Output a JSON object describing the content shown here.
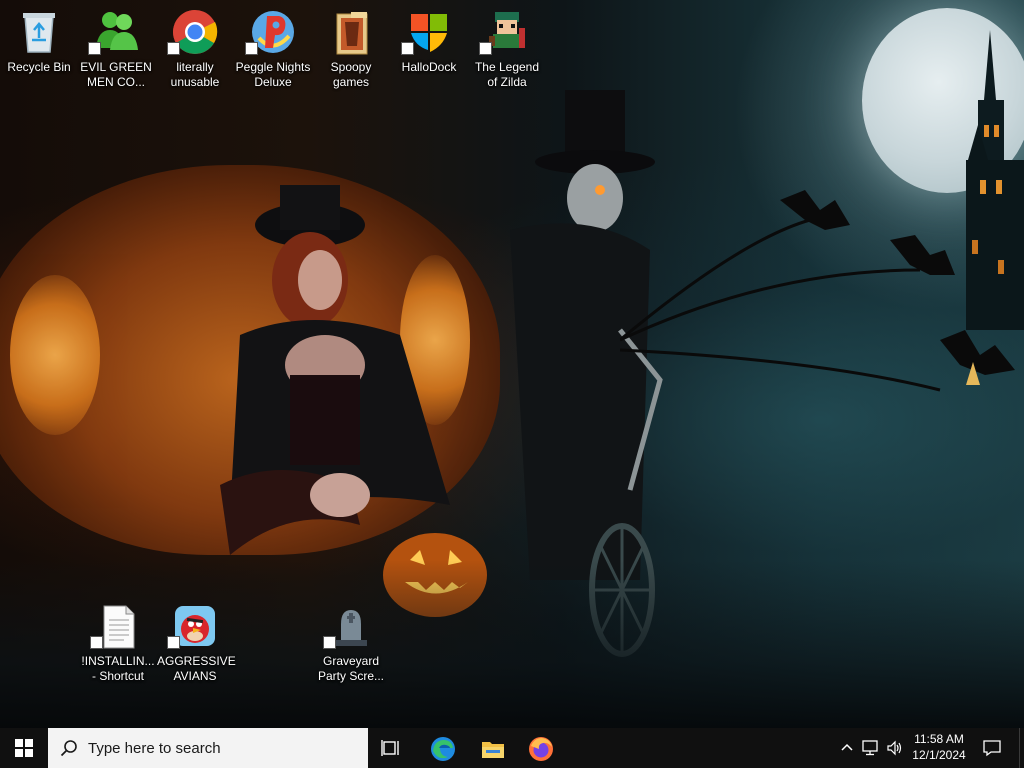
{
  "desktop": {
    "icons": [
      {
        "label": "Recycle Bin"
      },
      {
        "label": "EVIL GREEN MEN CO..."
      },
      {
        "label": "literally unusable"
      },
      {
        "label": "Peggle Nights Deluxe"
      },
      {
        "label": "Spoopy games"
      },
      {
        "label": "HalloDock"
      },
      {
        "label": "The Legend of Zilda"
      },
      {
        "label": "!INSTALLIN... - Shortcut"
      },
      {
        "label": "AGGRESSIVE AVIANS"
      },
      {
        "label": "Graveyard Party Scre..."
      }
    ]
  },
  "taskbar": {
    "search_placeholder": "Type here to search",
    "pinned": [
      "task-view",
      "microsoft-edge",
      "file-explorer",
      "firefox"
    ],
    "clock": {
      "time": "11:58 AM",
      "date": "12/1/2024"
    }
  },
  "colors": {
    "taskbar_bg": "#101010",
    "search_bg": "#f3f3f3",
    "windows_blue": "#ffffff",
    "edge_blue": "#1e8be0",
    "folder_yellow": "#f2c045",
    "firefox_orange": "#ff7139"
  }
}
